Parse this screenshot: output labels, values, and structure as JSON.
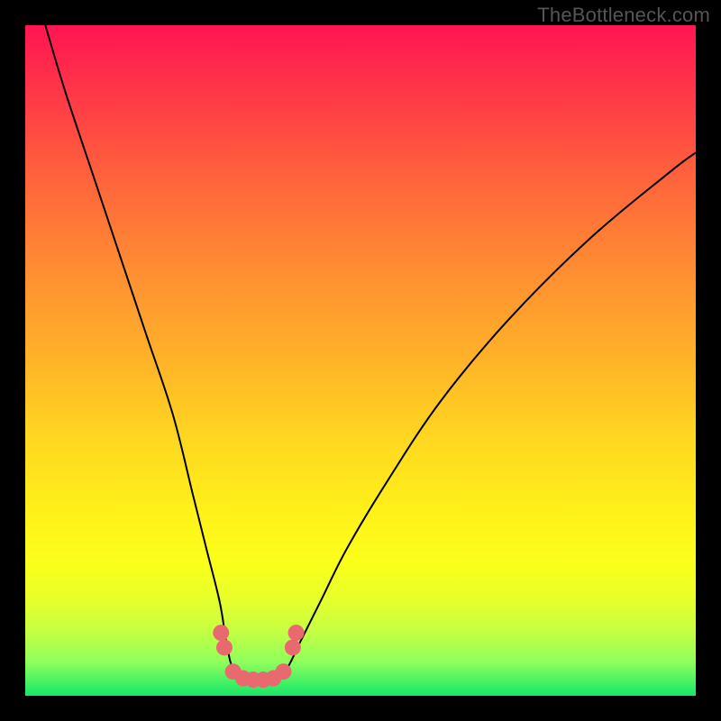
{
  "watermark": "TheBottleneck.com",
  "chart_data": {
    "type": "line",
    "title": "",
    "xlabel": "",
    "ylabel": "",
    "xlim": [
      0,
      100
    ],
    "ylim": [
      0,
      100
    ],
    "series": [
      {
        "name": "curve",
        "x": [
          3,
          6,
          10,
          14,
          18,
          22,
          25,
          27,
          29,
          30,
          31,
          33,
          35,
          37,
          39,
          41,
          44,
          48,
          54,
          62,
          72,
          84,
          96,
          100
        ],
        "y": [
          100,
          90,
          78,
          66,
          54,
          42,
          30,
          22,
          14,
          8,
          4,
          2,
          2,
          2,
          4,
          8,
          14,
          22,
          32,
          44,
          56,
          68,
          78,
          81
        ]
      }
    ],
    "markers": [
      {
        "x": 29.2,
        "y": 9.4
      },
      {
        "x": 29.7,
        "y": 7.2
      },
      {
        "x": 31.0,
        "y": 3.6
      },
      {
        "x": 32.5,
        "y": 2.6
      },
      {
        "x": 34.0,
        "y": 2.4
      },
      {
        "x": 35.5,
        "y": 2.4
      },
      {
        "x": 37.0,
        "y": 2.6
      },
      {
        "x": 38.5,
        "y": 3.6
      },
      {
        "x": 39.9,
        "y": 7.2
      },
      {
        "x": 40.4,
        "y": 9.4
      }
    ],
    "colors": {
      "curve": "#000000",
      "marker": "#e96a6e",
      "gradient_top": "#ff1452",
      "gradient_bottom": "#14e76a"
    }
  }
}
